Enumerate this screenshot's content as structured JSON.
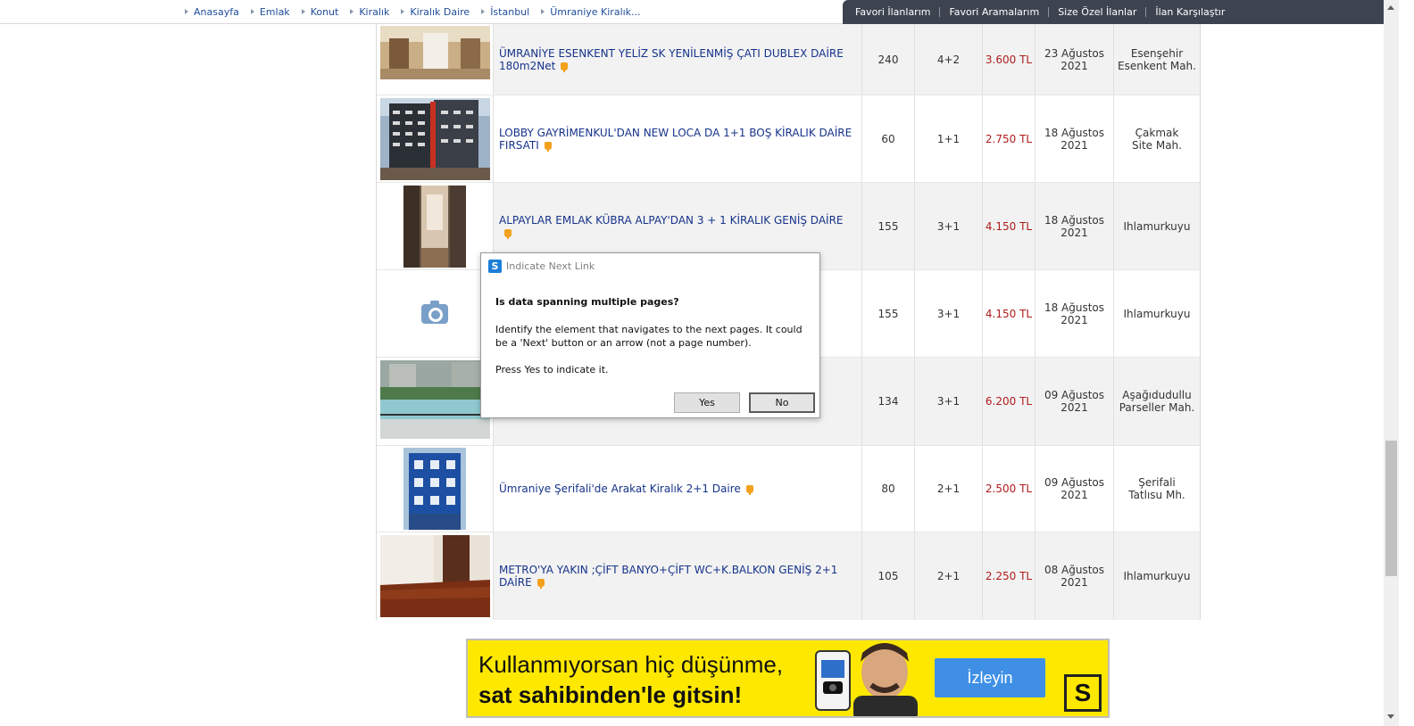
{
  "breadcrumbs": [
    "Anasayfa",
    "Emlak",
    "Konut",
    "Kiralık",
    "Kiralık Daire",
    "İstanbul",
    "Ümraniye Kiralık..."
  ],
  "top_links": [
    "Favori İlanlarım",
    "Favori Aramalarım",
    "Size Özel İlanlar",
    "İlan Karşılaştır"
  ],
  "listings": [
    {
      "title": "ÜMRANİYE ESENKENT YELİZ SK YENİLENMİŞ ÇATI DUBLEX DAİRE 180m2Net",
      "m2": "240",
      "rooms": "4+2",
      "price": "3.600 TL",
      "date_day": "23 Ağustos",
      "date_year": "2021",
      "loc1": "Esenşehir",
      "loc2": "Esenkent Mah."
    },
    {
      "title": "LOBBY GAYRİMENKUL'DAN NEW LOCA DA 1+1 BOŞ KİRALIK DAİRE FIRSATI",
      "m2": "60",
      "rooms": "1+1",
      "price": "2.750 TL",
      "date_day": "18 Ağustos",
      "date_year": "2021",
      "loc1": "Çakmak",
      "loc2": "Site Mah."
    },
    {
      "title": "ALPAYLAR EMLAK KÜBRA ALPAY'DAN 3 + 1 KİRALIK GENİŞ DAİRE",
      "m2": "155",
      "rooms": "3+1",
      "price": "4.150 TL",
      "date_day": "18 Ağustos",
      "date_year": "2021",
      "loc1": "Ihlamurkuyu",
      "loc2": ""
    },
    {
      "title": "",
      "m2": "155",
      "rooms": "3+1",
      "price": "4.150 TL",
      "date_day": "18 Ağustos",
      "date_year": "2021",
      "loc1": "Ihlamurkuyu",
      "loc2": ""
    },
    {
      "title": "",
      "m2": "134",
      "rooms": "3+1",
      "price": "6.200 TL",
      "date_day": "09 Ağustos",
      "date_year": "2021",
      "loc1": "Aşağıdudullu",
      "loc2": "Parseller Mah."
    },
    {
      "title": "Ümraniye Şerifali'de Arakat Kiralık 2+1 Daire",
      "m2": "80",
      "rooms": "2+1",
      "price": "2.500 TL",
      "date_day": "09 Ağustos",
      "date_year": "2021",
      "loc1": "Şerifali",
      "loc2": "Tatlısu Mh."
    },
    {
      "title": "METRO'YA YAKIN ;ÇİFT BANYO+ÇİFT WC+K.BALKON GENİŞ 2+1 DAİRE",
      "m2": "105",
      "rooms": "2+1",
      "price": "2.250 TL",
      "date_day": "08 Ağustos",
      "date_year": "2021",
      "loc1": "Ihlamurkuyu",
      "loc2": ""
    }
  ],
  "dialog": {
    "title": "Indicate Next Link",
    "heading": "Is data spanning multiple pages?",
    "body": "Identify the element that navigates to the next pages. It could be a 'Next' button or an arrow (not a page number).",
    "press": "Press Yes to indicate it.",
    "yes": "Yes",
    "no": "No",
    "app_icon_letter": "S"
  },
  "ad": {
    "line1": "Kullanmıyorsan hiç düşünme,",
    "line2": "sat sahibinden'le gitsin!",
    "button": "İzleyin",
    "logo": "S"
  },
  "colors": {
    "link": "#16338a",
    "price": "#b01c1c",
    "topnav": "#3d4450",
    "ad_bg": "#ffe800",
    "ad_button": "#3f8fe6"
  }
}
